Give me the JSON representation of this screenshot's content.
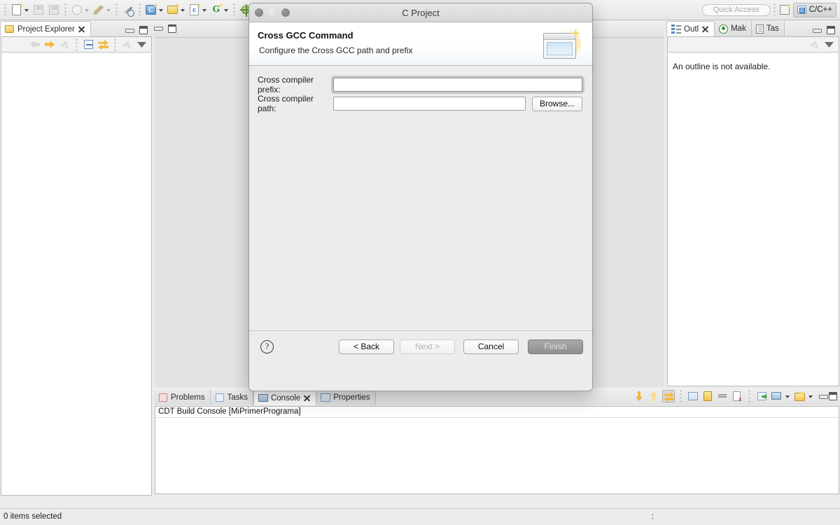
{
  "toolbar": {
    "items": [
      {
        "name": "new-wizard",
        "icon": "new-file-icon",
        "dropdown": true,
        "enabled": true
      },
      {
        "name": "save",
        "icon": "save-icon",
        "dropdown": false,
        "enabled": false
      },
      {
        "name": "save-all",
        "icon": "save-all-icon",
        "dropdown": false,
        "enabled": false
      },
      {
        "name": "build-all",
        "icon": "compass-icon",
        "dropdown": true,
        "enabled": false
      },
      {
        "name": "build",
        "icon": "hammer-icon",
        "dropdown": true,
        "enabled": false
      },
      {
        "name": "skip-breakpoints",
        "icon": "breakpoint-skip-icon",
        "dropdown": false,
        "enabled": true
      },
      {
        "name": "new-c-cpp-project",
        "icon": "c-project-icon",
        "dropdown": true,
        "enabled": true
      },
      {
        "name": "new-source-folder",
        "icon": "folder-new-icon",
        "dropdown": true,
        "enabled": true
      },
      {
        "name": "new-c-cpp-file",
        "icon": "c-file-icon",
        "dropdown": true,
        "enabled": true
      },
      {
        "name": "new-class",
        "icon": "g-class-icon",
        "dropdown": true,
        "enabled": true
      },
      {
        "name": "debug",
        "icon": "bug-icon",
        "dropdown": true,
        "enabled": true
      },
      {
        "name": "run",
        "icon": "run-icon",
        "dropdown": true,
        "enabled": true
      },
      {
        "name": "external-tools",
        "icon": "external-tools-icon",
        "dropdown": true,
        "enabled": true
      }
    ],
    "quick_access_placeholder": "Quick Access",
    "open_perspective_icon": "open-perspective-icon",
    "perspective_label": "C/C++"
  },
  "project_explorer": {
    "tab_label": "Project Explorer",
    "tab_icon": "project-explorer-icon",
    "toolbar_icons": [
      "back-arrow-icon",
      "forward-arrow-icon",
      "up-arrow-icon",
      "collapse-all-icon",
      "link-with-editor-icon",
      "focus-icon",
      "view-menu-icon"
    ],
    "minimize_icon": "minimize-icon",
    "maximize_icon": "maximize-icon"
  },
  "editor_area": {
    "minimize_icon": "minimize-icon",
    "maximize_icon": "maximize-icon"
  },
  "outline_panel": {
    "tabs": [
      {
        "label": "Outl",
        "icon": "outline-icon",
        "active": true,
        "closable": true
      },
      {
        "label": "Mak",
        "icon": "make-target-icon",
        "active": false,
        "closable": false
      },
      {
        "label": "Tas",
        "icon": "task-list-icon",
        "active": false,
        "closable": false
      }
    ],
    "message": "An outline is not available.",
    "toolbar_icons": [
      "focus-icon",
      "view-menu-icon"
    ],
    "minimize_icon": "minimize-icon",
    "maximize_icon": "maximize-icon"
  },
  "console_panel": {
    "tabs": [
      {
        "label": "Problems",
        "icon": "problems-icon",
        "active": false,
        "closable": false
      },
      {
        "label": "Tasks",
        "icon": "tasks-icon",
        "active": false,
        "closable": false
      },
      {
        "label": "Console",
        "icon": "console-icon",
        "active": true,
        "closable": true
      },
      {
        "label": "Properties",
        "icon": "properties-icon",
        "active": false,
        "closable": false
      }
    ],
    "console_title": "CDT Build Console [MiPrimerPrograma]",
    "toolbar_icons": [
      "scroll-down-icon",
      "scroll-up-icon",
      "scroll-lock-icon",
      "save-console-icon",
      "lock-console-icon",
      "clear-line-icon",
      "clear-console-icon",
      "pin-console-icon",
      "display-console-icon",
      "new-console-icon"
    ],
    "minimize_icon": "minimize-icon",
    "maximize_icon": "maximize-icon"
  },
  "status_bar": {
    "text": "0 items selected"
  },
  "dialog": {
    "window_title": "C Project",
    "heading": "Cross GCC Command",
    "subtitle": "Configure the Cross GCC path and prefix",
    "banner_icon": "wizard-banner-icon",
    "traffic_lights": [
      "close-button",
      "minimize-button",
      "zoom-button"
    ],
    "fields": [
      {
        "label": "Cross compiler prefix:",
        "value": "",
        "placeholder": "",
        "focused": true,
        "has_browse": false
      },
      {
        "label": "Cross compiler path:",
        "value": "",
        "placeholder": "",
        "focused": false,
        "has_browse": true,
        "browse_label": "Browse..."
      }
    ],
    "help_label": "?",
    "buttons": [
      {
        "label": "< Back",
        "state": "enabled"
      },
      {
        "label": "Next >",
        "state": "disabled"
      },
      {
        "label": "Cancel",
        "state": "enabled"
      },
      {
        "label": "Finish",
        "state": "default"
      }
    ]
  }
}
